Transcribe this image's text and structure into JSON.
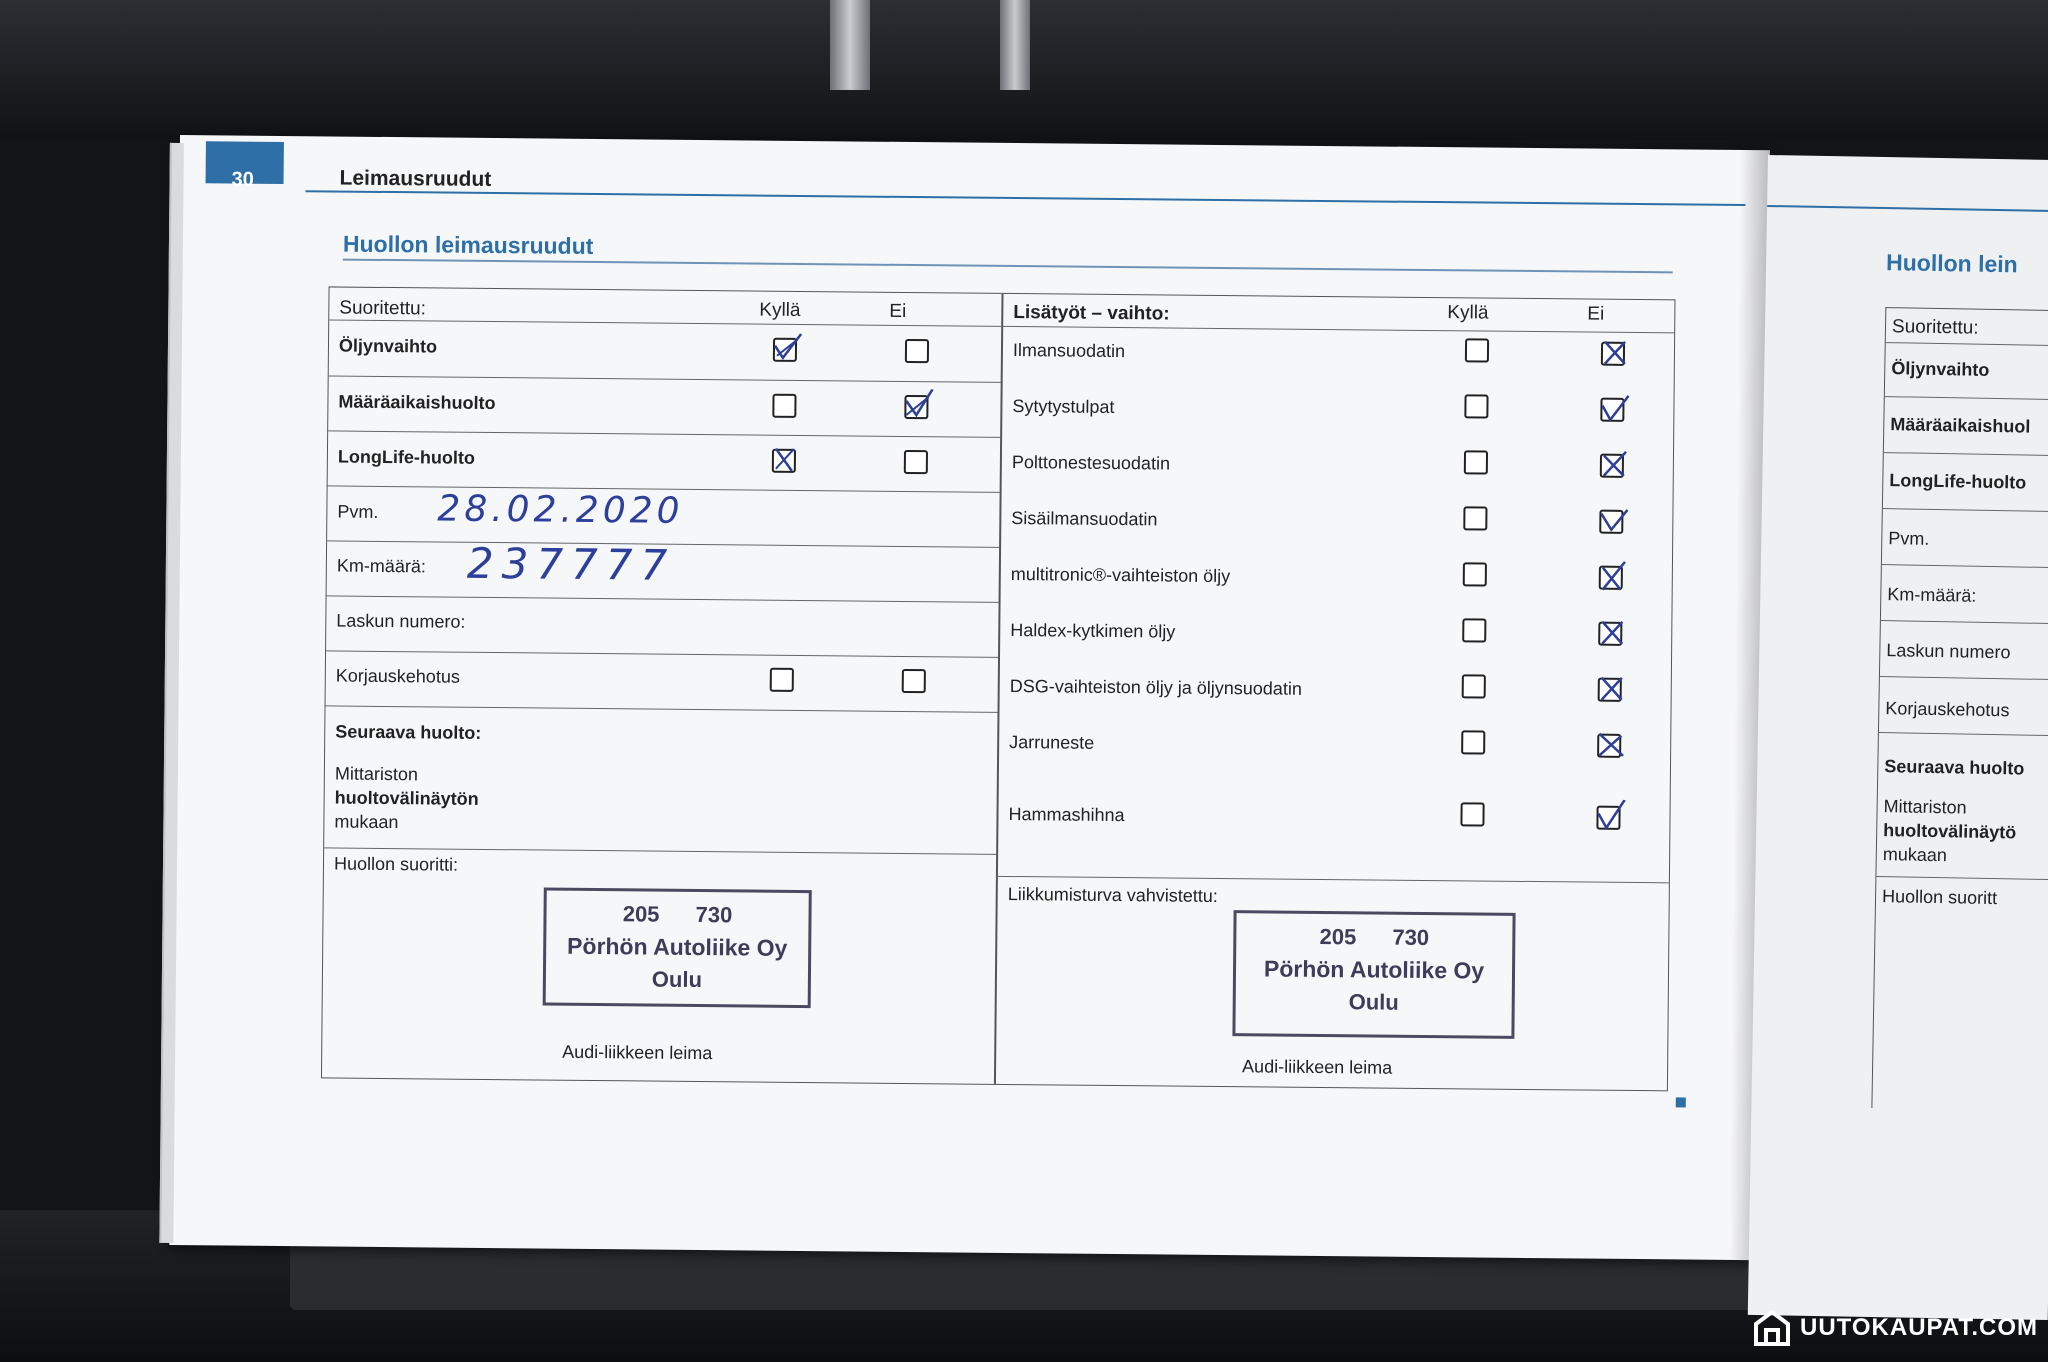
{
  "page": {
    "number": "30",
    "header": "Leimausruudut",
    "section_title": "Huollon leimausruudut"
  },
  "left_table": {
    "heading": "Suoritettu:",
    "col_yes": "Kyllä",
    "col_no": "Ei",
    "rows": [
      {
        "label": "Öljynvaihto",
        "yes": true,
        "no": false
      },
      {
        "label": "Määräaikaishuolto",
        "yes": false,
        "no": true
      },
      {
        "label": "LongLife-huolto",
        "yes": true,
        "no": false
      }
    ],
    "date_label": "Pvm.",
    "date_value": "28.02.2020",
    "km_label": "Km-määrä:",
    "km_value": "237777",
    "invoice_label": "Laskun numero:",
    "repair_label": "Korjauskehotus",
    "next_label": "Seuraava huolto:",
    "next_line1": "Mittariston",
    "next_line2": "huoltovälinäytön",
    "next_line3": "mukaan",
    "service_done_label": "Huollon suoritti:",
    "dealer_stamp_label": "Audi-liikkeen leima"
  },
  "right_table": {
    "heading": "Lisätyöt – vaihto:",
    "col_yes": "Kyllä",
    "col_no": "Ei",
    "rows": [
      {
        "label": "Ilmansuodatin",
        "no": true
      },
      {
        "label": "Sytytystulpat",
        "no": true
      },
      {
        "label": "Polttonestesuodatin",
        "no": true
      },
      {
        "label": "Sisäilmansuodatin",
        "no": true
      },
      {
        "label": "multitronic®-vaihteiston öljy",
        "no": true
      },
      {
        "label": "Haldex-kytkimen öljy",
        "no": true
      },
      {
        "label": "DSG-vaihteiston öljy ja öljynsuodatin",
        "no": true
      },
      {
        "label": "Jarruneste",
        "no": true
      },
      {
        "label": "Hammashihna",
        "no": true
      }
    ],
    "mobility_label": "Liikkumisturva vahvistettu:",
    "dealer_stamp_label": "Audi-liikkeen leima"
  },
  "stamp": {
    "line1": "205 730",
    "line2": "Pörhön Autoliike Oy",
    "line3": "Oulu"
  },
  "right_page": {
    "section_title": "Huollon lein",
    "labels": [
      "Suoritettu:",
      "Öljynvaihto",
      "Määräaikaishuol",
      "LongLife-huolto",
      "Pvm.",
      "Km-määrä:",
      "Laskun numero",
      "Korjauskehotus",
      "Seuraava huolto",
      "Mittariston",
      "huoltovälinäytö",
      "mukaan",
      "Huollon suoritt"
    ]
  },
  "watermark": {
    "text": "UUTOKAUPAT.COM",
    "color": "#ffffff"
  },
  "colors": {
    "accent": "#2d6fa6",
    "ink": "#2c3f9a",
    "stamp": "#3d3d5a"
  }
}
